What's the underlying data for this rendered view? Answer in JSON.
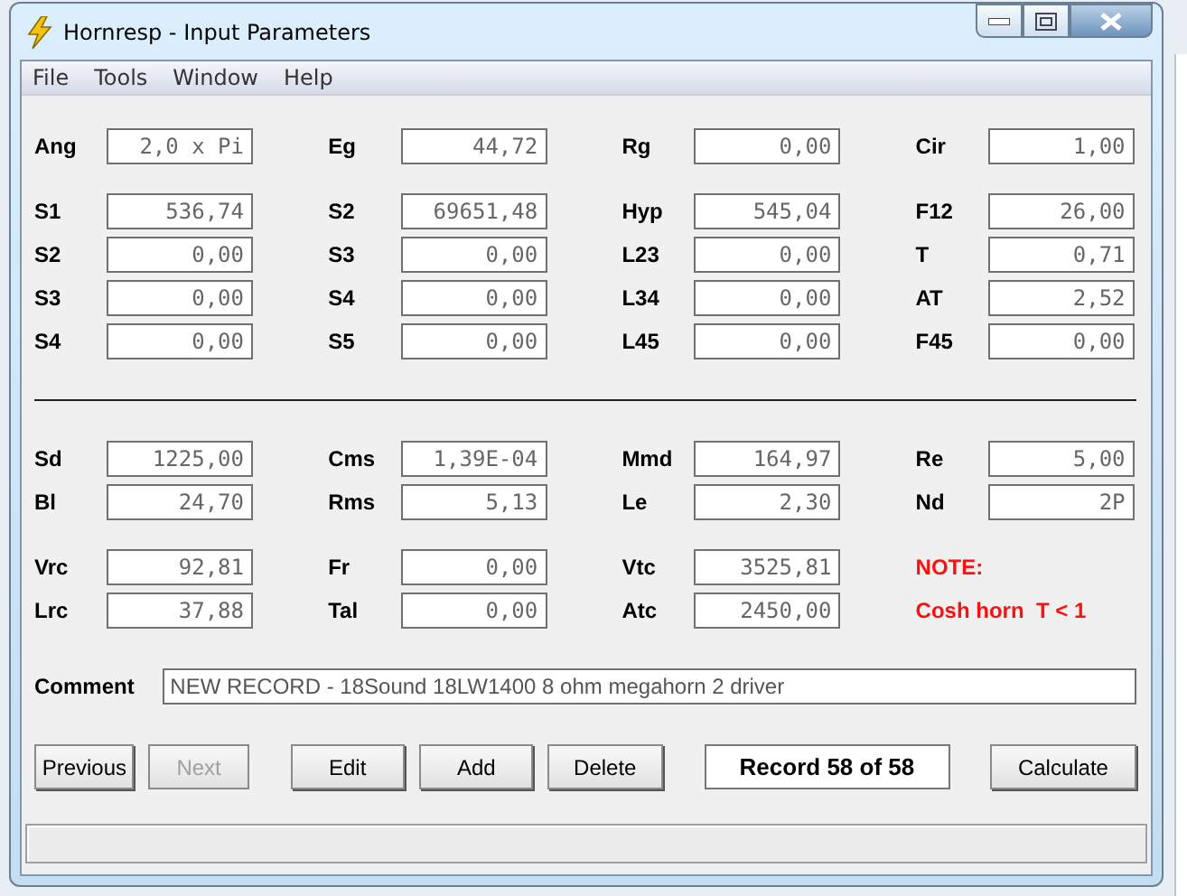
{
  "window": {
    "title": "Hornresp - Input Parameters"
  },
  "menu": [
    {
      "label": "File"
    },
    {
      "label": "Tools"
    },
    {
      "label": "Window"
    },
    {
      "label": "Help"
    }
  ],
  "panels": [
    {
      "groups": [
        [
          [
            {
              "kind": "field",
              "label": "Ang",
              "value": "2,0 x Pi"
            },
            {
              "kind": "field",
              "label": "Eg",
              "value": "44,72"
            },
            {
              "kind": "field",
              "label": "Rg",
              "value": "0,00"
            },
            {
              "kind": "field",
              "label": "Cir",
              "value": "1,00"
            }
          ]
        ],
        [
          [
            {
              "kind": "field",
              "label": "S1",
              "value": "536,74"
            },
            {
              "kind": "field",
              "label": "S2",
              "value": "69651,48"
            },
            {
              "kind": "field",
              "label": "Hyp",
              "value": "545,04"
            },
            {
              "kind": "field",
              "label": "F12",
              "value": "26,00"
            }
          ],
          [
            {
              "kind": "field",
              "label": "S2",
              "value": "0,00"
            },
            {
              "kind": "field",
              "label": "S3",
              "value": "0,00"
            },
            {
              "kind": "field",
              "label": "L23",
              "value": "0,00"
            },
            {
              "kind": "field",
              "label": "T",
              "value": "0,71"
            }
          ],
          [
            {
              "kind": "field",
              "label": "S3",
              "value": "0,00"
            },
            {
              "kind": "field",
              "label": "S4",
              "value": "0,00"
            },
            {
              "kind": "field",
              "label": "L34",
              "value": "0,00"
            },
            {
              "kind": "field",
              "label": "AT",
              "value": "2,52"
            }
          ],
          [
            {
              "kind": "field",
              "label": "S4",
              "value": "0,00"
            },
            {
              "kind": "field",
              "label": "S5",
              "value": "0,00"
            },
            {
              "kind": "field",
              "label": "L45",
              "value": "0,00"
            },
            {
              "kind": "field",
              "label": "F45",
              "value": "0,00"
            }
          ]
        ]
      ]
    },
    {
      "groups": [
        [
          [
            {
              "kind": "field",
              "label": "Sd",
              "value": "1225,00"
            },
            {
              "kind": "field",
              "label": "Cms",
              "value": "1,39E-04"
            },
            {
              "kind": "field",
              "label": "Mmd",
              "value": "164,97"
            },
            {
              "kind": "field",
              "label": "Re",
              "value": "5,00"
            }
          ],
          [
            {
              "kind": "field",
              "label": "Bl",
              "value": "24,70"
            },
            {
              "kind": "field",
              "label": "Rms",
              "value": "5,13"
            },
            {
              "kind": "field",
              "label": "Le",
              "value": "2,30"
            },
            {
              "kind": "field",
              "label": "Nd",
              "value": "2P"
            }
          ]
        ],
        [
          [
            {
              "kind": "field",
              "label": "Vrc",
              "value": "92,81"
            },
            {
              "kind": "field",
              "label": "Fr",
              "value": "0,00"
            },
            {
              "kind": "field",
              "label": "Vtc",
              "value": "3525,81"
            },
            {
              "kind": "note",
              "text": "NOTE:"
            }
          ],
          [
            {
              "kind": "field",
              "label": "Lrc",
              "value": "37,88"
            },
            {
              "kind": "field",
              "label": "Tal",
              "value": "0,00"
            },
            {
              "kind": "field",
              "label": "Atc",
              "value": "2450,00"
            },
            {
              "kind": "note",
              "text": "Cosh horn  T < 1"
            }
          ]
        ]
      ]
    }
  ],
  "comment": {
    "label": "Comment",
    "value": "NEW RECORD - 18Sound 18LW1400 8 ohm megahorn 2 driver"
  },
  "buttons": [
    {
      "kind": "button",
      "label": "Previous",
      "disabled": false
    },
    {
      "kind": "button",
      "label": "Next",
      "disabled": true
    },
    {
      "kind": "button",
      "label": "Edit",
      "disabled": false
    },
    {
      "kind": "button",
      "label": "Add",
      "disabled": false
    },
    {
      "kind": "button",
      "label": "Delete",
      "disabled": false
    },
    {
      "kind": "record",
      "label": "Record 58 of 58"
    },
    {
      "kind": "button",
      "label": "Calculate",
      "disabled": false
    }
  ]
}
